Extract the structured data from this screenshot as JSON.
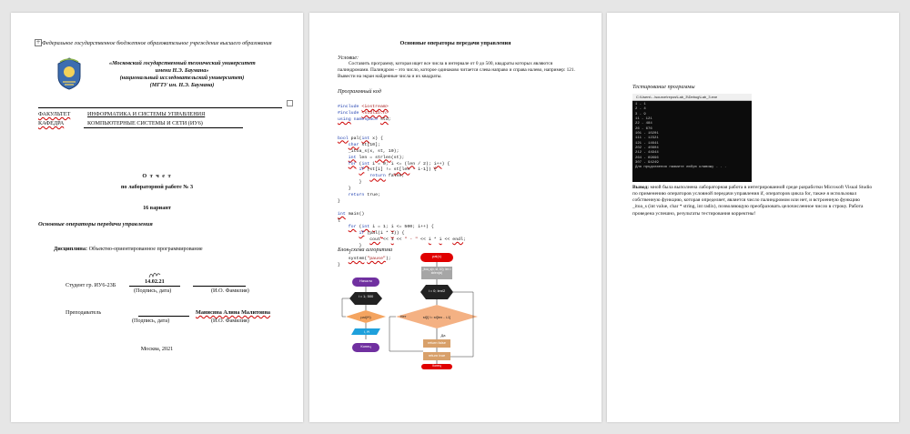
{
  "page1": {
    "institution": "Федеральное государственное бюджетное образовательное учреждение высшего образования",
    "university": [
      "«Московский государственный технический университет",
      "имени Н.Э. Баумана»",
      "(национальный исследовательский университет)",
      "(МГТУ им. Н.Э. Баумана)"
    ],
    "faculty_label": "ФАКУЛЬТЕТ",
    "faculty": "ИНФОРМАТИКА И СИСТЕМЫ УПРАВЛЕНИЯ",
    "department_label": "КАФЕДРА",
    "department": "КОМПЬЮТЕРНЫЕ СИСТЕМЫ И СЕТИ (ИУ6)",
    "report": "О т ч е т",
    "lab": "по лабораторной работе № 3",
    "variant": "16 вариант",
    "topic": "Основные операторы передачи управления",
    "discipline_label": "Дисциплина:",
    "discipline": "Объектно-ориентированное программирование",
    "student": "Студент   гр.   ИУ6-23Б",
    "date": "14.02.21",
    "signature_caption": "(Подпись, дата)",
    "name_caption": "(И.О. Фамилия)",
    "teacher": "Преподаватель",
    "teacher_name": "Манисяна Алина Малитовна",
    "city": "Москва, 2021"
  },
  "page2": {
    "title": "Основные операторы передачи управления",
    "condition_label": "Условие:",
    "condition": "Составить программу, которая ищет все числа в интервале от 0 до 500, квадраты которых являются палиндромами. Палиндром – это число, которое одинаково читается слева направо и справа налево, например: 121. Вывести на экран найденные числа и их квадраты.",
    "code_label": "Программный код",
    "code": [
      "#include <iostream>",
      "#include <stdlib.h>",
      "using namespace std;",
      "",
      "",
      "bool pal(int x) {",
      "    char st[10];",
      "    _itoa_s(x, st, 10);",
      "    int len = strlen(st);",
      "    for (int i = 0; i <= (len / 2); i++) {",
      "        if (st[i] != st[len - i-1]) {",
      "            return false;",
      "        }",
      "    }",
      "    return true;",
      "}",
      "",
      "int main()",
      "{",
      "    for (int i = 1; i <= 500; i++) {",
      "        if (pal(i * i)) {",
      "            cout << i << \" - \" << i * i << endl;",
      "        }",
      "    }",
      "    system(\"pause\");",
      "}"
    ],
    "flow_label": "Блок-схема алгоритма",
    "flow": {
      "start": "Начало",
      "end": "Конец",
      "loop1": "i = 1; 500",
      "cond1": "pal(i*i)",
      "output": "i, i*i",
      "fn": "pal(x)",
      "fn_step": "_itoa_s(x, st, 10); len = strlen(st)",
      "loop2": "i = 0; len/2",
      "cond2": "st[i] != st[len - i-1]",
      "yes": "Да",
      "no": "Нет",
      "ret_false": "return false",
      "ret_true": "return true",
      "fn_end": "Конец"
    }
  },
  "page3": {
    "test_label": "Тестирование программы",
    "console_title": "C:\\Users\\...\\source\\repos\\Lab_3\\Debug\\Lab_3.exe",
    "console_lines": [
      "1 - 1",
      "2 - 4",
      "3 - 9",
      "11 - 121",
      "22 - 484",
      "26 - 676",
      "101 - 10201",
      "111 - 12321",
      "121 - 14641",
      "202 - 40804",
      "212 - 44944",
      "264 - 69696",
      "307 - 94249",
      "Для продолжения нажмите любую клавишу . . ."
    ],
    "conclusion_label": "Вывод:",
    "conclusion": "мной была выполнена лабораторная работа в интегрированной среде разработки Microsoft Visual Studio по применению операторов условной передачи управления if, операторов цикла for, также я использовал собственную функцию, которая определяет, является число палиндромом или нет, и встроенную функцию _itoa_s (int value, char * string, int radix), позволяющую преобразовать целочисленное число в строку. Работа проведена успешно, результаты тестирования корректны!"
  }
}
